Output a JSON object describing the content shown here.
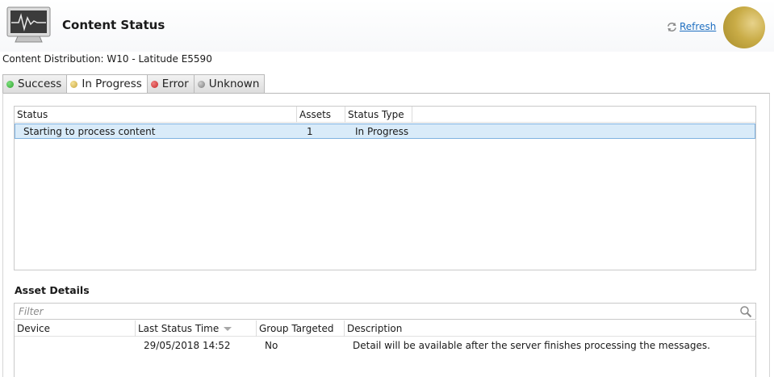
{
  "header": {
    "icon": "monitor-pulse-icon",
    "title": "Content Status",
    "refresh_label": "Refresh",
    "avatar_color": "#c9ac47"
  },
  "subtitle": "Content Distribution:  W10 - Latitude E5590",
  "tabs": [
    {
      "label": "Success",
      "dot_color": "#2ea32e",
      "active": false
    },
    {
      "label": "In Progress",
      "dot_color": "#d4b93e",
      "active": true
    },
    {
      "label": "Error",
      "dot_color": "#d32f2f",
      "active": false
    },
    {
      "label": "Unknown",
      "dot_color": "#8c8c8c",
      "active": false
    }
  ],
  "status_grid": {
    "columns": [
      "Status",
      "Assets",
      "Status Type"
    ],
    "rows": [
      {
        "status": "Starting to process content",
        "assets": "1",
        "status_type": "In Progress",
        "selected": true
      }
    ]
  },
  "asset_details": {
    "title": "Asset Details",
    "filter_placeholder": "Filter",
    "columns": [
      "Device",
      "Last Status Time",
      "Group Targeted",
      "Description"
    ],
    "rows": [
      {
        "device": "",
        "last_status_time": "29/05/2018 14:52",
        "group_targeted": "No",
        "description": "Detail will be available after the server finishes processing the messages."
      }
    ]
  },
  "colors": {
    "link": "#1f6fc1",
    "selected_row": "#d9ebf9",
    "selected_border": "#7fb2e0"
  }
}
